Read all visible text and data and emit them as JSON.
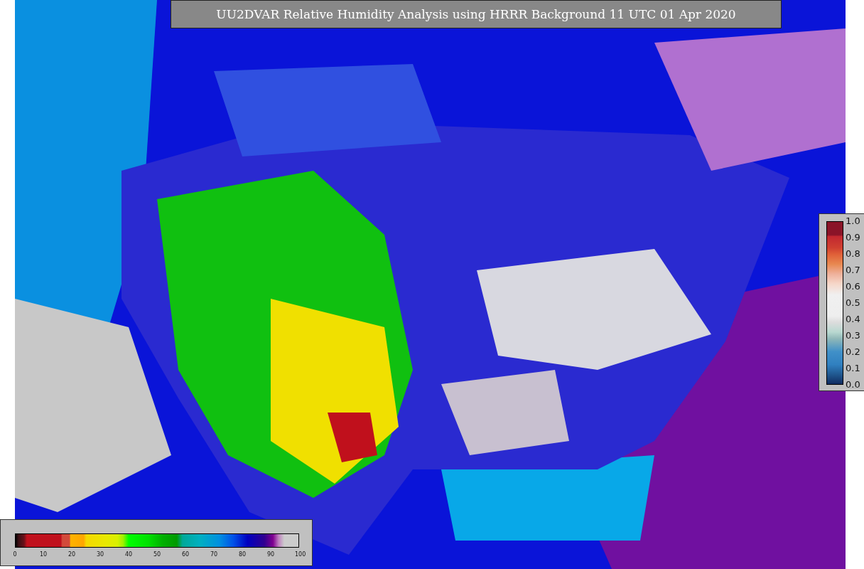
{
  "title": "UU2DVAR Relative Humidity Analysis using HRRR Background 11 UTC 01 Apr 2020",
  "colorbar_horizontal": {
    "ticks": [
      "0",
      "10",
      "20",
      "30",
      "40",
      "50",
      "60",
      "70",
      "80",
      "90",
      "100"
    ]
  },
  "colorbar_vertical": {
    "ticks": [
      "1.0",
      "0.9",
      "0.8",
      "0.7",
      "0.6",
      "0.5",
      "0.4",
      "0.3",
      "0.2",
      "0.1",
      "0.0"
    ]
  }
}
